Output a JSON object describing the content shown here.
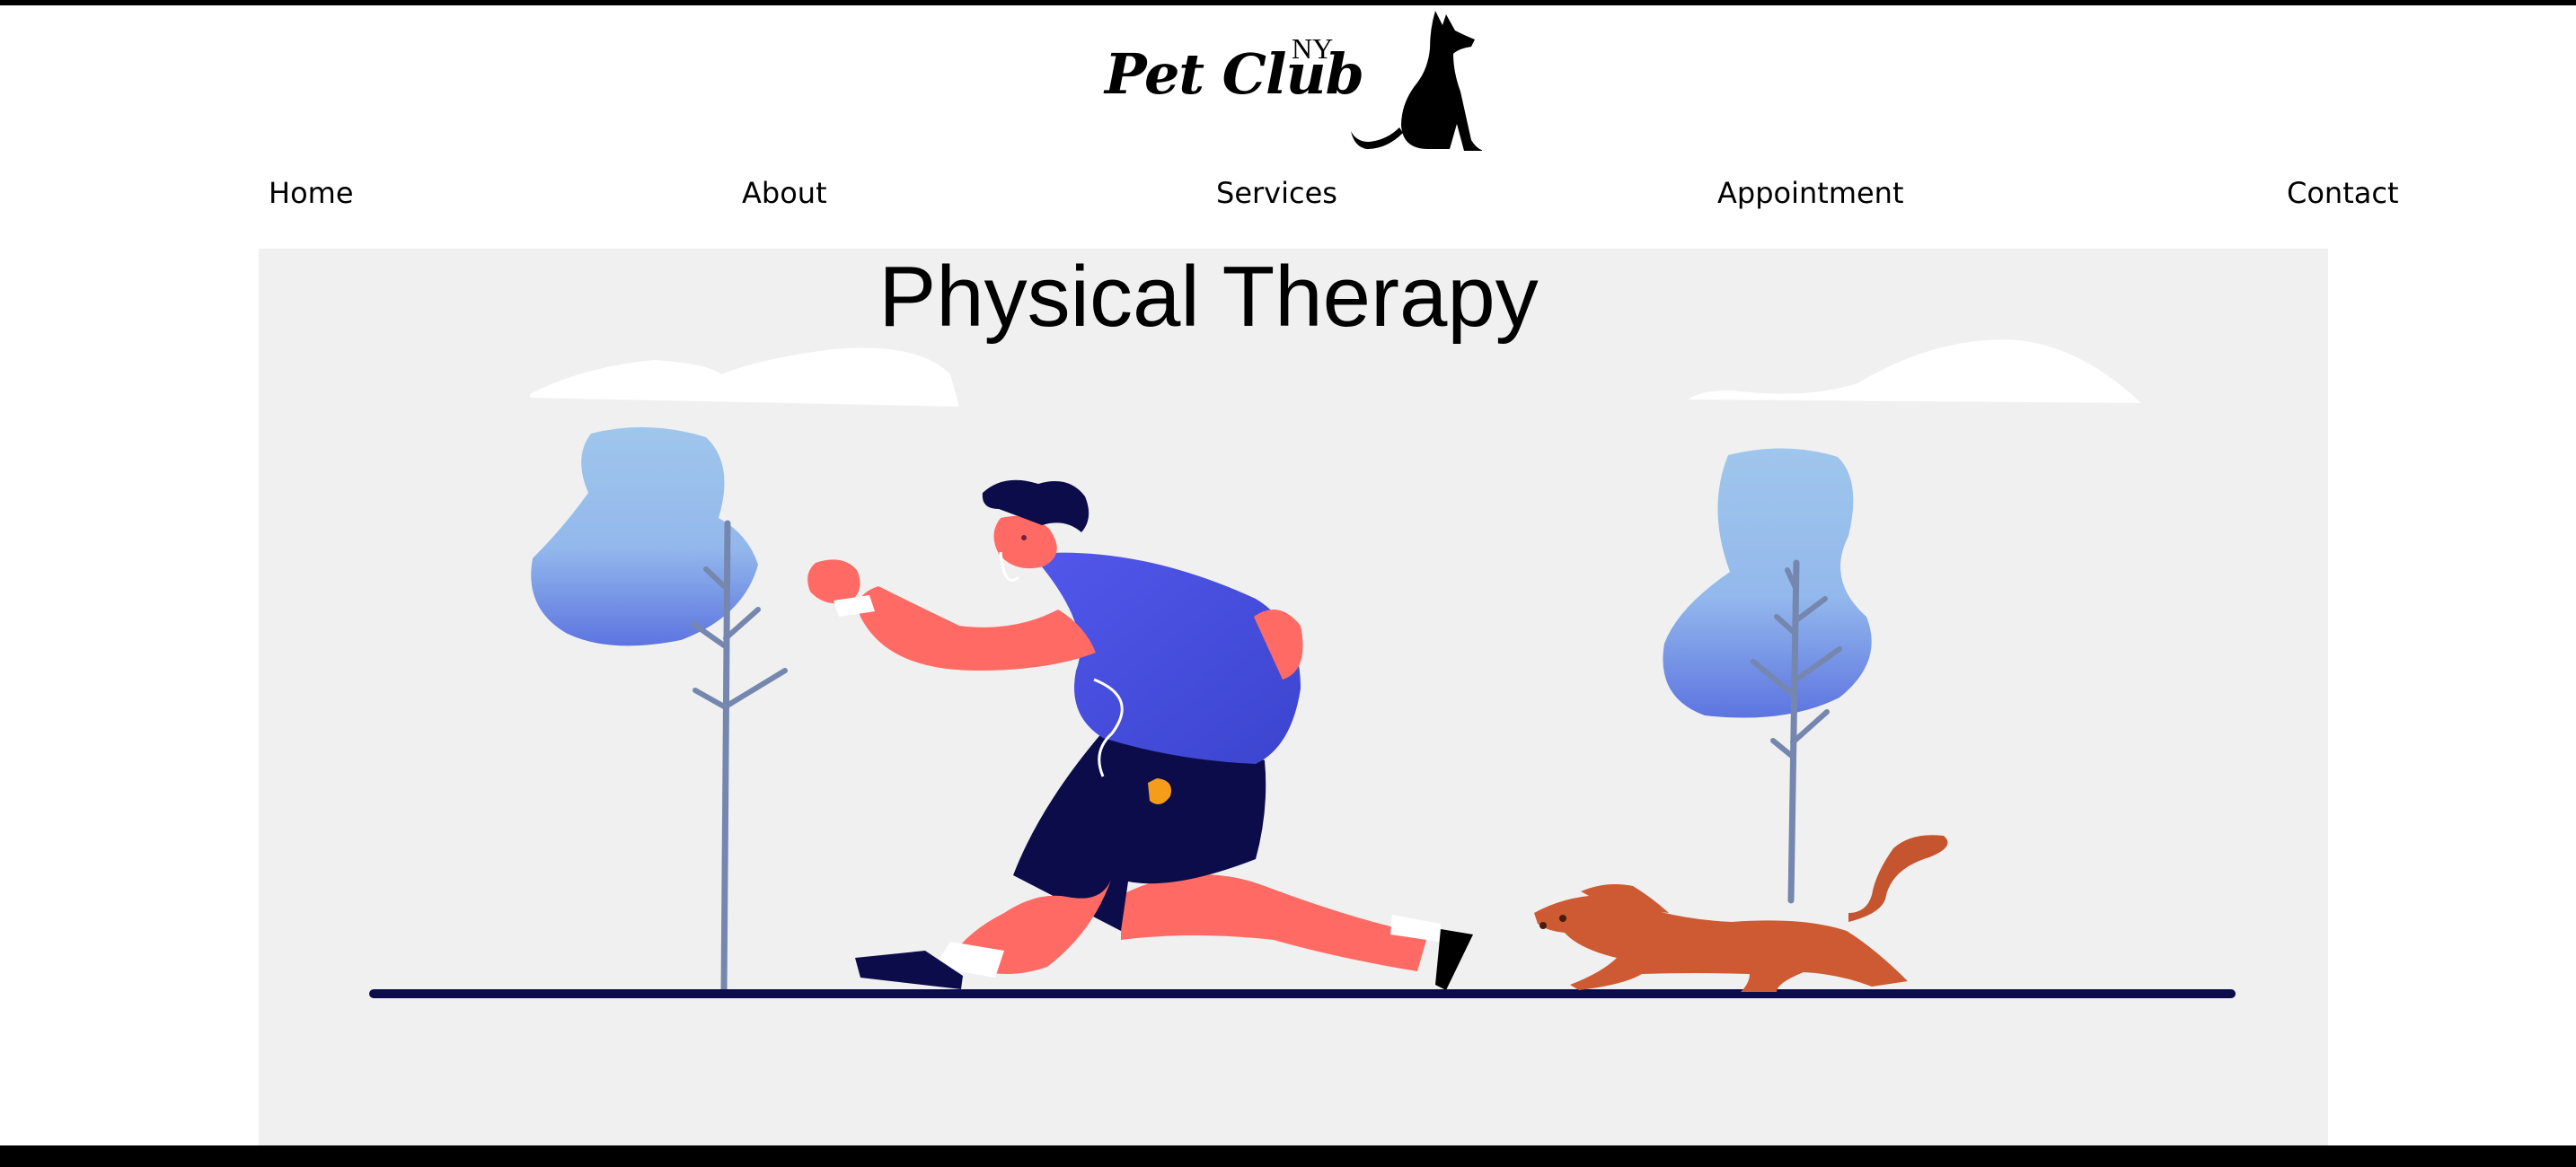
{
  "brand": {
    "name": "Pet Club",
    "superscript": "NY",
    "logo_icon": "sitting-dog-silhouette-icon"
  },
  "nav": {
    "items": [
      {
        "label": "Home"
      },
      {
        "label": "About"
      },
      {
        "label": "Services"
      },
      {
        "label": "Appointment"
      },
      {
        "label": "Contact"
      }
    ]
  },
  "hero": {
    "title": "Physical Therapy",
    "illustration": "runner-with-dog-illustration"
  },
  "colors": {
    "hero_background": "#f0f0f0",
    "shirt": "#4a52e0",
    "skin": "#ff6b64",
    "tree_top": "#9fc6ec",
    "dog": "#cd5a33",
    "ground": "#0c0c4a"
  }
}
